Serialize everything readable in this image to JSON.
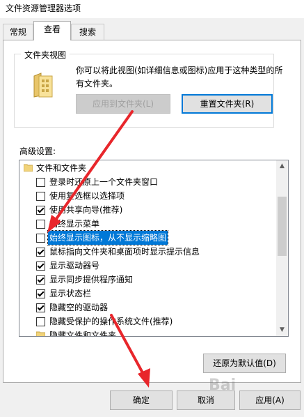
{
  "window": {
    "title": "文件资源管理器选项"
  },
  "tabs": [
    {
      "label": "常规",
      "active": false
    },
    {
      "label": "查看",
      "active": true
    },
    {
      "label": "搜索",
      "active": false
    }
  ],
  "folder_view": {
    "legend": "文件夹视图",
    "description": "你可以将此视图(如详细信息或图标)应用于这种类型的所有文件夹。",
    "apply_button": "应用到文件夹(L)",
    "reset_button": "重置文件夹(R)"
  },
  "advanced": {
    "label": "高级设置:",
    "items": [
      {
        "label": "文件和文件夹",
        "type": "folder"
      },
      {
        "label": "登录时还原上一个文件夹窗口",
        "type": "checkbox",
        "checked": false
      },
      {
        "label": "使用复选框以选择项",
        "type": "checkbox",
        "checked": false
      },
      {
        "label": "使用共享向导(推荐)",
        "type": "checkbox",
        "checked": true
      },
      {
        "label": "始终显示菜单",
        "type": "checkbox",
        "checked": false
      },
      {
        "label": "始终显示图标，从不显示缩略图",
        "type": "checkbox",
        "checked": false,
        "highlighted": true
      },
      {
        "label": "鼠标指向文件夹和桌面项时显示提示信息",
        "type": "checkbox",
        "checked": true
      },
      {
        "label": "显示驱动器号",
        "type": "checkbox",
        "checked": true
      },
      {
        "label": "显示同步提供程序通知",
        "type": "checkbox",
        "checked": true
      },
      {
        "label": "显示状态栏",
        "type": "checkbox",
        "checked": true
      },
      {
        "label": "隐藏空的驱动器",
        "type": "checkbox",
        "checked": true
      },
      {
        "label": "隐藏受保护的操作系统文件(推荐)",
        "type": "checkbox",
        "checked": false
      },
      {
        "label": "隐藏文件和文件夹",
        "type": "folder"
      }
    ],
    "restore_button": "还原为默认值(D)"
  },
  "footer": {
    "ok_button": "确定",
    "cancel_button": "取消",
    "apply_button": "应用(A)"
  },
  "watermark": "Bai",
  "colors": {
    "selection": "#0078d7",
    "annotation_arrow": "#e8262b"
  }
}
